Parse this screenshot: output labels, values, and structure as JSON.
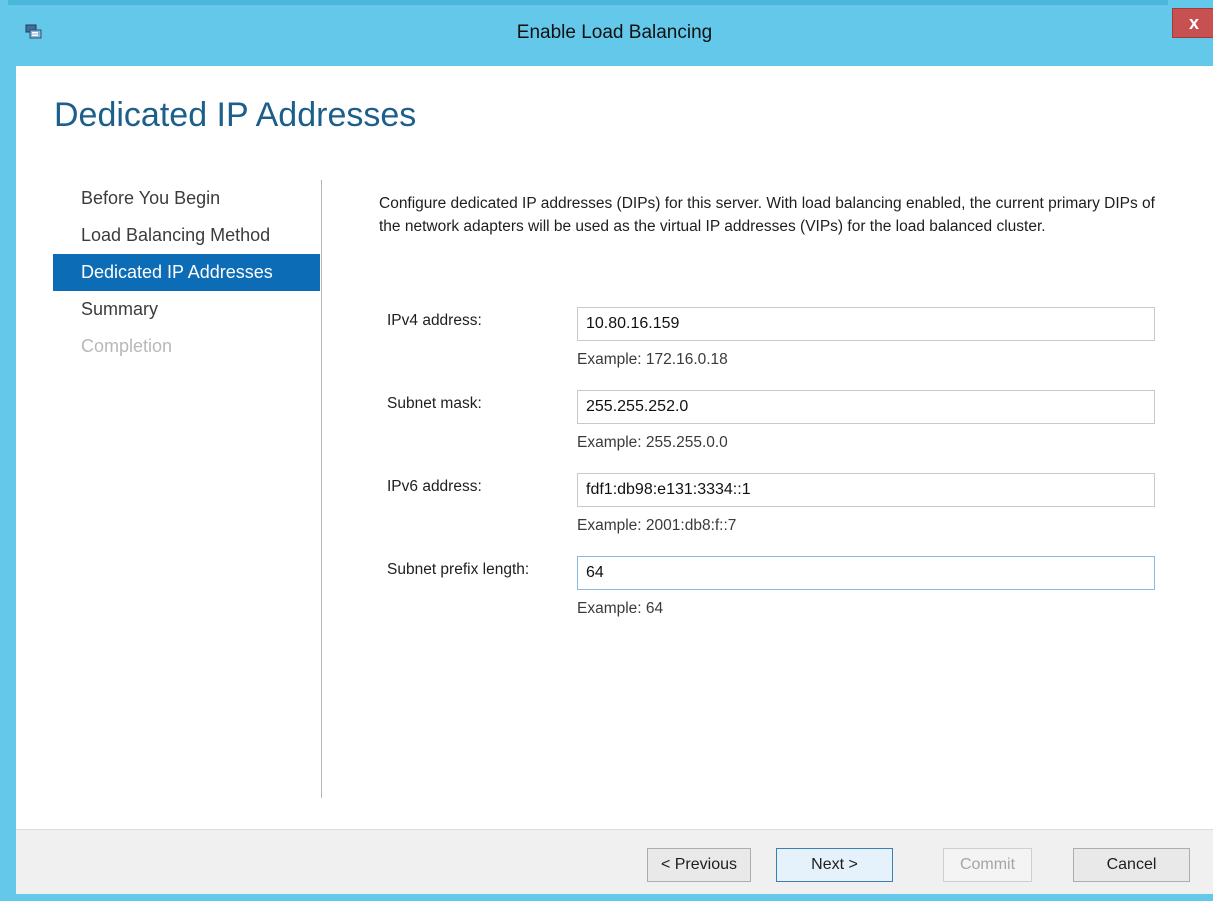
{
  "window": {
    "title": "Enable Load Balancing",
    "close_label": "x"
  },
  "page": {
    "title": "Dedicated IP Addresses",
    "description": "Configure dedicated IP addresses (DIPs) for this server. With load balancing enabled, the current primary DIPs of the network adapters will be used as the virtual IP addresses (VIPs) for the load balanced cluster."
  },
  "nav": {
    "items": [
      {
        "label": "Before You Begin",
        "state": "normal"
      },
      {
        "label": "Load Balancing Method",
        "state": "normal"
      },
      {
        "label": "Dedicated IP Addresses",
        "state": "active"
      },
      {
        "label": "Summary",
        "state": "normal"
      },
      {
        "label": "Completion",
        "state": "disabled"
      }
    ]
  },
  "form": {
    "ipv4": {
      "label": "IPv4 address:",
      "value": "10.80.16.159",
      "example": "Example: 172.16.0.18"
    },
    "subnet_mask": {
      "label": "Subnet mask:",
      "value": "255.255.252.0",
      "example": "Example: 255.255.0.0"
    },
    "ipv6": {
      "label": "IPv6 address:",
      "value": "fdf1:db98:e131:3334::1",
      "example": "Example: 2001:db8:f::7"
    },
    "prefix": {
      "label": "Subnet prefix length:",
      "value": "64",
      "example": "Example: 64"
    }
  },
  "footer": {
    "previous_label": "< Previous",
    "next_label": "Next >",
    "commit_label": "Commit",
    "cancel_label": "Cancel"
  },
  "colors": {
    "title_bar": "#63c8e9",
    "active_nav": "#0c6cb6",
    "page_title": "#1c5f8a",
    "close_button": "#c75050"
  }
}
